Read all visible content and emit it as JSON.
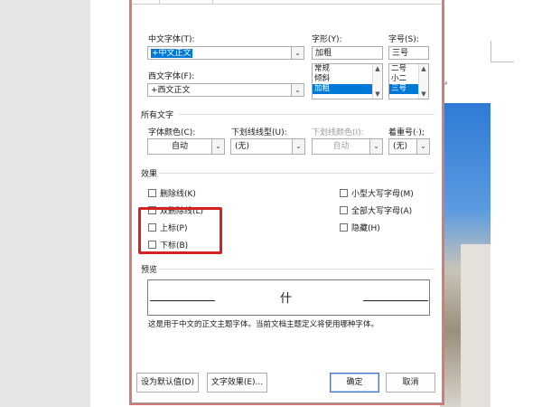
{
  "doc": {
    "para_mark": "↵"
  },
  "dialog": {
    "chinese_font": {
      "label": "中文字体(T):",
      "value": "+中文正文"
    },
    "western_font": {
      "label": "西文字体(F):",
      "value": "+西文正文"
    },
    "style": {
      "label": "字形(Y):",
      "value": "加粗",
      "options": [
        "常规",
        "倾斜",
        "加粗"
      ]
    },
    "size": {
      "label": "字号(S):",
      "value": "三号",
      "options": [
        "二号",
        "小二",
        "三号"
      ]
    },
    "all_text_section": "所有文字",
    "font_color": {
      "label": "字体颜色(C):",
      "value": "自动"
    },
    "underline_style": {
      "label": "下划线线型(U):",
      "value": "(无)"
    },
    "underline_color": {
      "label": "下划线颜色(I):",
      "value": "自动"
    },
    "emphasis": {
      "label": "着重号(·);",
      "value": "(无)"
    },
    "effects_section": "效果",
    "effects_left": [
      "删除线(K)",
      "双删除线(L)",
      "上标(P)",
      "下标(B)"
    ],
    "effects_right": [
      "小型大写字母(M)",
      "全部大写字母(A)",
      "隐藏(H)"
    ],
    "preview_section": "预览",
    "preview_char": "什",
    "preview_note": "这是用于中文的正文主题字体。当前文档主题定义将使用哪种字体。",
    "buttons": {
      "set_default": "设为默认值(D)",
      "text_effects": "文字效果(E)...",
      "ok": "确定",
      "cancel": "取消"
    }
  },
  "colors": {
    "highlight": "#d42222",
    "selection": "#0078d7"
  }
}
